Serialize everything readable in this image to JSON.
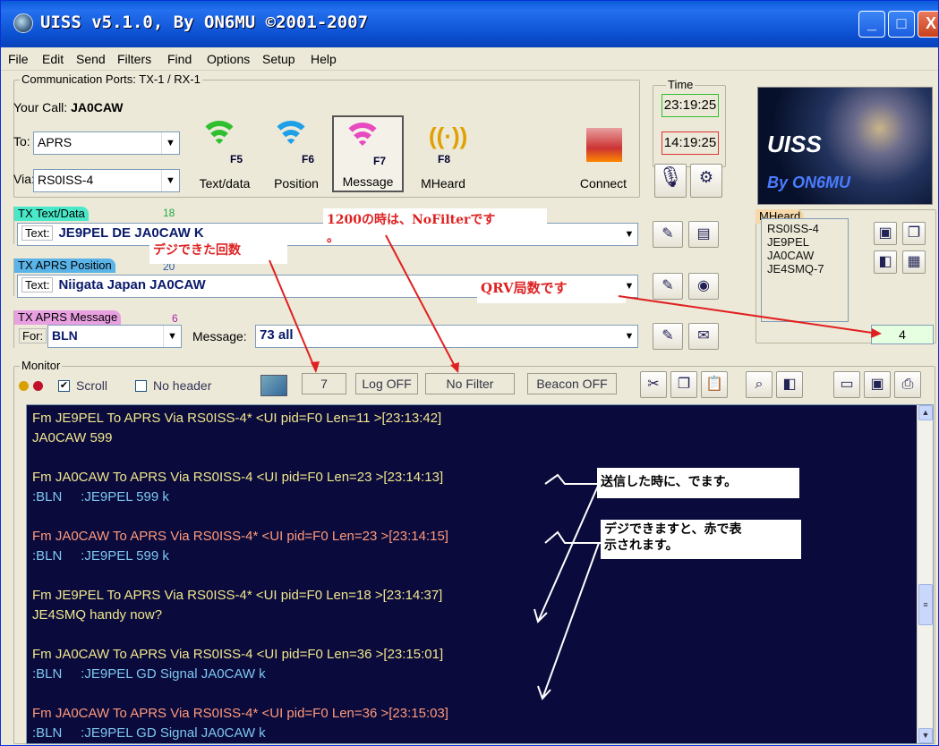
{
  "window": {
    "title": "UISS v5.1.0, By ON6MU ©2001-2007",
    "min": "_",
    "max": "□",
    "close": "X"
  },
  "menu": [
    "File",
    "Edit",
    "Send",
    "Filters",
    "Find",
    "Options",
    "Setup",
    "Help"
  ],
  "ports": {
    "label": "Communication Ports: TX-1 / RX-1",
    "your_call_label": "Your Call:",
    "your_call": "JA0CAW",
    "to_label": "To:",
    "to": "APRS",
    "via_label": "Via:",
    "via": "RS0ISS-4"
  },
  "buttons": [
    {
      "key": "F5",
      "label": "Text/data"
    },
    {
      "key": "F6",
      "label": "Position"
    },
    {
      "key": "F7",
      "label": "Message"
    },
    {
      "key": "F8",
      "label": "MHeard"
    }
  ],
  "connect_label": "Connect",
  "time": {
    "label": "Time",
    "utc": "23:19:25",
    "local": "14:19:25"
  },
  "logo": {
    "title": "UISS",
    "by": "By ON6MU"
  },
  "tx_text": {
    "label": "TX Text/Data",
    "count": "18",
    "prefix": "Text:",
    "value": "JE9PEL DE JA0CAW K"
  },
  "tx_pos": {
    "label": "TX APRS Position",
    "count": "20",
    "prefix": "Text:",
    "value": "Niigata Japan JA0CAW"
  },
  "tx_msg": {
    "label": "TX APRS Message",
    "count": "6",
    "for_label": "For:",
    "for": "BLN",
    "msg_label": "Message:",
    "msg": "73 all"
  },
  "mheard": {
    "label": "MHeard",
    "items": [
      "RS0ISS-4",
      "JE9PEL",
      "JA0CAW",
      "JE4SMQ-7"
    ],
    "count": "4"
  },
  "monitor": {
    "label": "Monitor",
    "scroll": "Scroll",
    "no_header": "No header",
    "digi_count": "7",
    "log": "Log OFF",
    "filter": "No Filter",
    "beacon": "Beacon OFF"
  },
  "lines": [
    {
      "text": "Fm JE9PEL To APRS Via RS0ISS-4* <UI pid=F0 Len=11 >[23:13:42]",
      "color": "#f0e68c"
    },
    {
      "text": "JA0CAW 599",
      "color": "#f0e68c"
    },
    {
      "text": "Fm JA0CAW To APRS Via RS0ISS-4 <UI pid=F0 Len=23 >[23:14:13]",
      "color": "#f0e68c"
    },
    {
      "text": ":BLN     :JE9PEL 599 k",
      "color": "#7ec8f0"
    },
    {
      "text": "Fm JA0CAW To APRS Via RS0ISS-4* <UI pid=F0 Len=23 >[23:14:15]",
      "color": "#ff9a7a"
    },
    {
      "text": ":BLN     :JE9PEL 599 k",
      "color": "#7ec8f0"
    },
    {
      "text": "Fm JE9PEL To APRS Via RS0ISS-4* <UI pid=F0 Len=18 >[23:14:37]",
      "color": "#f0e68c"
    },
    {
      "text": "JE4SMQ handy now?",
      "color": "#f0e68c"
    },
    {
      "text": "Fm JA0CAW To APRS Via RS0ISS-4 <UI pid=F0 Len=36 >[23:15:01]",
      "color": "#f0e68c"
    },
    {
      "text": ":BLN     :JE9PEL GD Signal JA0CAW k",
      "color": "#7ec8f0"
    },
    {
      "text": "Fm JA0CAW To APRS Via RS0ISS-4* <UI pid=F0 Len=36 >[23:15:03]",
      "color": "#ff9a7a"
    },
    {
      "text": ":BLN     :JE9PEL GD Signal JA0CAW k",
      "color": "#7ec8f0"
    }
  ],
  "annotations": {
    "nofilter": "1200の時は、NoFilterです",
    "nofilter2": "。",
    "digi": "デジできた回数",
    "qrv": "QRV局数です",
    "sent": "送信した時に、でます。",
    "red1": "デジできますと、赤で表",
    "red2": "示されます。"
  }
}
